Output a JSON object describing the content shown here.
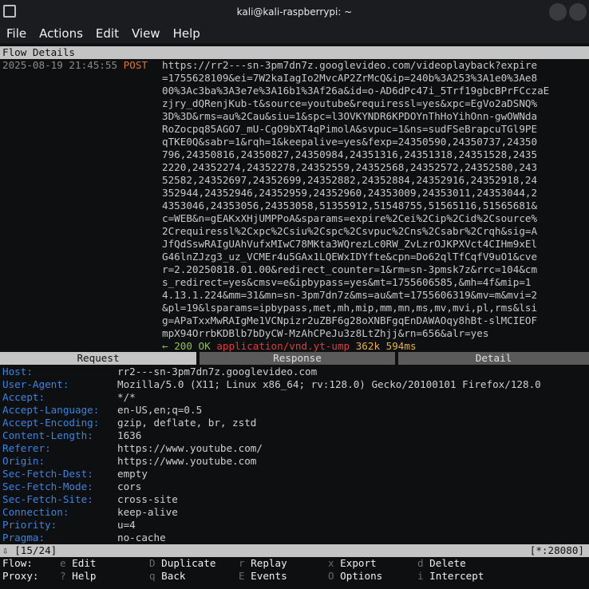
{
  "window": {
    "title": "kali@kali-raspberrypi: ~"
  },
  "menu": [
    "File",
    "Actions",
    "Edit",
    "View",
    "Help"
  ],
  "flow": {
    "section_title": "Flow Details",
    "timestamp": "2025-08-19 21:45:55",
    "method": "POST",
    "url_lines": [
      "https://rr2---sn-3pm7dn7z.googlevideo.com/videoplayback?expire",
      "=1755628109&ei=7W2kaIagIo2MvcAP2ZrMcQ&ip=240b%3A253%3A1e0%3Ae8",
      "00%3Ac3ba%3A3e7e%3A16b1%3Af26a&id=o-AD6dPc47i_5Trf19gbcBPrFCczaE",
      "zjry_dQRenjKub-t&source=youtube&requiressl=yes&xpc=EgVo2aDSNQ%",
      "3D%3D&rms=au%2Cau&siu=1&spc=l3OVKYNDR6KPDOYnThHoYihOnn-gwOWNda",
      "RoZocpq85AGO7_mU-CgO9bXT4qPimolA&svpuc=1&ns=sudFSeBrapcuTGl9PE",
      "qTKE0Q&sabr=1&rqh=1&keepalive=yes&fexp=24350590,24350737,24350",
      "796,24350816,24350827,24350984,24351316,24351318,24351528,2435",
      "2220,24352274,24352278,24352559,24352568,24352572,24352580,243",
      "52582,24352697,24352699,24352882,24352884,24352916,24352918,24",
      "352944,24352946,24352959,24352960,24353009,24353011,24353044,2",
      "4353046,24353056,24353058,51355912,51548755,51565116,51565681&",
      "c=WEB&n=gEAKxXHjUMPPoA&sparams=expire%2Cei%2Cip%2Cid%2Csource%",
      "2Crequiressl%2Cxpc%2Csiu%2Cspc%2Csvpuc%2Cns%2Csabr%2Crqh&sig=A",
      "JfQdSswRAIgUAhVufxMIwC78MKta3WQrezLc0RW_ZvLzrOJKPXVct4CIHm9xEl",
      "G46lnZJzg3_uz_VCMEr4u5GAx1LQEWxIDYfte&cpn=Do62qlTfCqfV9uO1&cve",
      "r=2.20250818.01.00&redirect_counter=1&rm=sn-3pmsk7z&rrc=104&cm",
      "s_redirect=yes&cmsv=e&ipbypass=yes&mt=1755606585,&mh=4f&mip=1",
      "4.13.1.224&mm=31&mn=sn-3pm7dn7z&ms=au&mt=1755606319&mv=m&mvi=2",
      "&pl=19&lsparams=ipbypass,met,mh,mip,mm,mn,ms,mv,mvi,pl,rms&lsi",
      "g=APaTxxMwRAIgMe1VCNpizr2uZBF6g28oXNBFgqEnDAWAOqy8hBt-slMCIEOF",
      "mpX94OrrbKDBlb7bDyCW-MzAhCPeJu3z8LtZhjj&rn=656&alr=yes"
    ],
    "response_arrow": "←",
    "status_code": "200",
    "status_text": "OK",
    "content_type": "application/vnd.yt-ump",
    "size": "362k",
    "duration": "594ms"
  },
  "tabs": [
    "Request",
    "Response",
    "Detail"
  ],
  "headers": [
    {
      "name": "Host:",
      "value": "rr2---sn-3pm7dn7z.googlevideo.com"
    },
    {
      "name": "User-Agent:",
      "value": "Mozilla/5.0 (X11; Linux x86_64; rv:128.0) Gecko/20100101 Firefox/128.0"
    },
    {
      "name": "Accept:",
      "value": "*/*"
    },
    {
      "name": "Accept-Language:",
      "value": "en-US,en;q=0.5"
    },
    {
      "name": "Accept-Encoding:",
      "value": "gzip, deflate, br, zstd"
    },
    {
      "name": "Content-Length:",
      "value": "1636"
    },
    {
      "name": "Referer:",
      "value": "https://www.youtube.com/"
    },
    {
      "name": "Origin:",
      "value": "https://www.youtube.com"
    },
    {
      "name": "Sec-Fetch-Dest:",
      "value": "empty"
    },
    {
      "name": "Sec-Fetch-Mode:",
      "value": "cors"
    },
    {
      "name": "Sec-Fetch-Site:",
      "value": "cross-site"
    },
    {
      "name": "Connection:",
      "value": "keep-alive"
    },
    {
      "name": "Priority:",
      "value": "u=4"
    },
    {
      "name": "Pragma:",
      "value": "no-cache"
    }
  ],
  "status": {
    "arrow": "⇩",
    "position": "[15/24]",
    "listen": "[*:28080]"
  },
  "keybar": {
    "row1_label": "Flow:",
    "row2_label": "Proxy:",
    "row1": [
      {
        "key": "e",
        "label": "Edit"
      },
      {
        "key": "D",
        "label": "Duplicate"
      },
      {
        "key": "r",
        "label": "Replay"
      },
      {
        "key": "x",
        "label": "Export"
      },
      {
        "key": "d",
        "label": "Delete"
      }
    ],
    "row2": [
      {
        "key": "?",
        "label": "Help"
      },
      {
        "key": "q",
        "label": "Back"
      },
      {
        "key": "E",
        "label": "Events"
      },
      {
        "key": "O",
        "label": "Options"
      },
      {
        "key": "i",
        "label": "Intercept"
      }
    ]
  }
}
